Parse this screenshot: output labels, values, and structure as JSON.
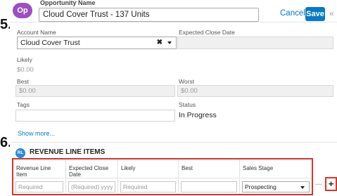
{
  "edge_marks": [
    "5.",
    "6."
  ],
  "header": {
    "badge": "Op",
    "opportunity_label": "Opportunity Name",
    "opportunity_value": "Cloud Cover Trust - 137 Units",
    "cancel_label": "Cancel",
    "save_label": "Save",
    "collapse_icon": "«"
  },
  "fields": {
    "account_name": {
      "label": "Account Name",
      "value": "Cloud Cover Trust"
    },
    "expected_close_date": {
      "label": "Expected Close Date",
      "value": ""
    },
    "likely": {
      "label": "Likely",
      "value": "$0.00"
    },
    "best": {
      "label": "Best",
      "value": "$0.00"
    },
    "worst": {
      "label": "Worst",
      "value": "$0.00"
    },
    "tags": {
      "label": "Tags",
      "value": ""
    },
    "status": {
      "label": "Status",
      "value": "In Progress"
    }
  },
  "show_more": "Show more...",
  "revenue_line_items": {
    "badge": "RL",
    "title": "REVENUE LINE ITEMS",
    "columns": [
      "Revenue Line Item",
      "Expected Close Date",
      "Likely",
      "Best",
      "Sales Stage"
    ],
    "row": {
      "item_placeholder": "Required",
      "date_placeholder": "(Required) yyyy",
      "likely_placeholder": "Required",
      "best_placeholder": "",
      "sales_stage": "Prospecting"
    },
    "remove_label": "—",
    "add_label": "+"
  },
  "icons": {
    "clear": "clear-x-icon",
    "calendar": "calendar-icon",
    "dropdown": "chevron-down-icon"
  },
  "colors": {
    "accent": "#0679c8",
    "opportunity_badge": "#9b4fc2",
    "rli_badge": "#2a8bd8",
    "highlight": "#d9342b"
  }
}
